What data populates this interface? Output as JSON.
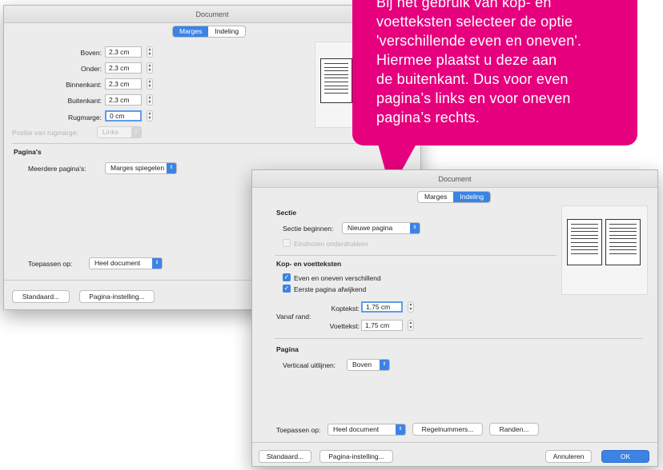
{
  "colors": {
    "accent": "#3c83e4",
    "callout": "#e6007e"
  },
  "dialog1": {
    "title": "Document",
    "tabs": [
      "Marges",
      "Indeling"
    ],
    "fields": [
      {
        "label": "Boven:",
        "value": "2,3 cm"
      },
      {
        "label": "Onder:",
        "value": "2,3 cm"
      },
      {
        "label": "Binnenkant:",
        "value": "2,3 cm"
      },
      {
        "label": "Buitenkant:",
        "value": "2,3 cm"
      },
      {
        "label": "Rugmarge:",
        "value": "0 cm"
      }
    ],
    "gutter_position": {
      "label": "Positie van rugmarge:",
      "value": "Links"
    },
    "pages_heading": "Pagina's",
    "multiple_pages": {
      "label": "Meerdere pagina's:",
      "value": "Marges spiegelen"
    },
    "apply": {
      "label": "Toepassen op:",
      "value": "Heel document"
    },
    "buttons": {
      "default": "Standaard...",
      "page_setup": "Pagina-instelling..."
    }
  },
  "callout": {
    "lines": [
      "Bij het gebruik van kop- en",
      "voetteksten selecteer de optie",
      "'verschillende even en oneven'.",
      "Hiermee plaatst u deze aan",
      "de buitenkant. Dus voor even",
      "pagina’s links en voor oneven",
      "pagina’s rechts."
    ]
  },
  "dialog2": {
    "title": "Document",
    "tabs": [
      "Marges",
      "Indeling"
    ],
    "section_heading": "Sectie",
    "section_start": {
      "label": "Sectie beginnen:",
      "value": "Nieuwe pagina"
    },
    "suppress_endnotes": "Eindnoten onderdrukken",
    "headers_heading": "Kop- en voetteksten",
    "different_odd_even": "Even en oneven verschillend",
    "different_first": "Eerste pagina afwijkend",
    "from_edge": "Vanaf rand:",
    "header": {
      "label": "Koptekst:",
      "value": "1,75 cm"
    },
    "footer": {
      "label": "Voettekst:",
      "value": "1,75 cm"
    },
    "page_heading": "Pagina",
    "vertical_align": {
      "label": "Verticaal uitlijnen:",
      "value": "Boven"
    },
    "apply": {
      "label": "Toepassen op:",
      "value": "Heel document"
    },
    "buttons": {
      "line_numbers": "Regelnummers...",
      "borders": "Randen...",
      "default": "Standaard...",
      "page_setup": "Pagina-instelling...",
      "cancel": "Annuleren",
      "ok": "OK"
    }
  }
}
